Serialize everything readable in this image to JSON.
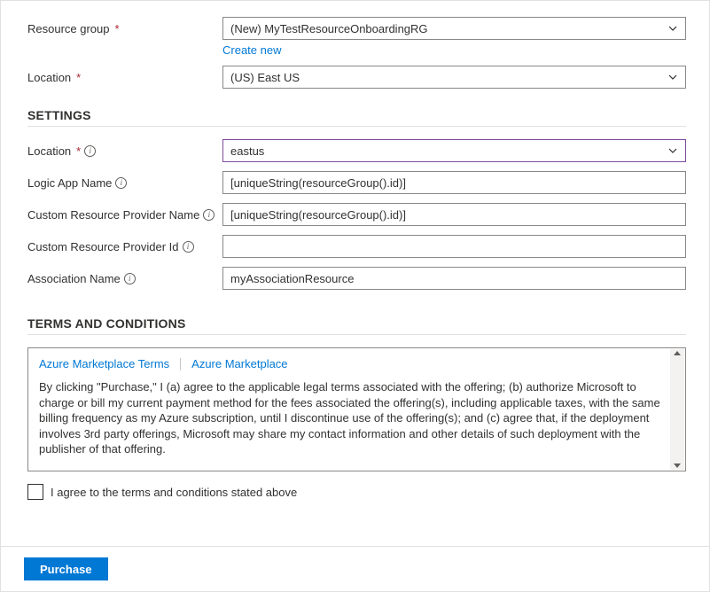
{
  "basics": {
    "resource_group_label": "Resource group",
    "resource_group_value": "(New) MyTestResourceOnboardingRG",
    "create_new_link": "Create new",
    "location_label": "Location",
    "location_value": "(US) East US"
  },
  "settings": {
    "heading": "SETTINGS",
    "location_label": "Location",
    "location_value": "eastus",
    "logic_app_label": "Logic App Name",
    "logic_app_value": "[uniqueString(resourceGroup().id)]",
    "crp_name_label": "Custom Resource Provider Name",
    "crp_name_value": "[uniqueString(resourceGroup().id)]",
    "crp_id_label": "Custom Resource Provider Id",
    "crp_id_value": "",
    "assoc_name_label": "Association Name",
    "assoc_name_value": "myAssociationResource"
  },
  "terms": {
    "heading": "TERMS AND CONDITIONS",
    "link1": "Azure Marketplace Terms",
    "link2": "Azure Marketplace",
    "body": "By clicking \"Purchase,\" I (a) agree to the applicable legal terms associated with the offering; (b) authorize Microsoft to charge or bill my current payment method for the fees associated the offering(s), including applicable taxes, with the same billing frequency as my Azure subscription, until I discontinue use of the offering(s); and (c) agree that, if the deployment involves 3rd party offerings, Microsoft may share my contact information and other details of such deployment with the publisher of that offering.",
    "agree_label": "I agree to the terms and conditions stated above"
  },
  "footer": {
    "purchase_label": "Purchase"
  },
  "icons": {
    "info_glyph": "i"
  }
}
